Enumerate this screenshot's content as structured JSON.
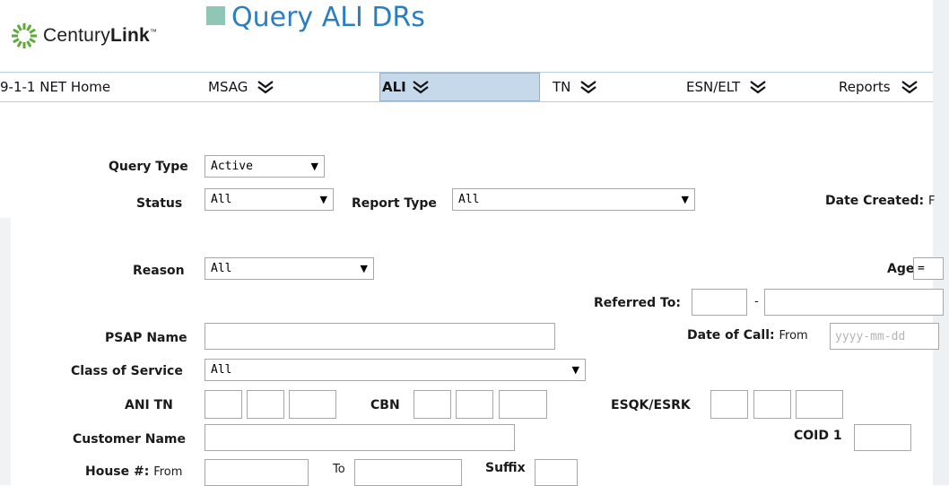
{
  "header": {
    "brand": "CenturyLink",
    "brand_plain": "Century",
    "brand_bold": "Link",
    "brand_tm": "™",
    "page_title": "Query ALI DRs"
  },
  "nav": {
    "items": [
      {
        "label": "9-1-1 NET Home"
      },
      {
        "label": "MSAG"
      },
      {
        "label": "ALI"
      },
      {
        "label": "TN"
      },
      {
        "label": "ESN/ELT"
      },
      {
        "label": "Reports"
      }
    ],
    "active": "ALI"
  },
  "form": {
    "query_type": {
      "label": "Query Type",
      "value": "Active"
    },
    "status": {
      "label": "Status",
      "value": "All"
    },
    "report_type": {
      "label": "Report Type",
      "value": "All"
    },
    "date_created": {
      "label": "Date Created:",
      "from": "F"
    },
    "reason": {
      "label": "Reason",
      "value": "All"
    },
    "age": {
      "label": "Age",
      "operator": "="
    },
    "referred_to": {
      "label": "Referred To:",
      "separator": "-"
    },
    "psap_name": {
      "label": "PSAP Name",
      "value": ""
    },
    "date_of_call": {
      "label": "Date of Call:",
      "from": "From",
      "placeholder": "yyyy-mm-dd"
    },
    "class_of_service": {
      "label": "Class of Service",
      "value": "All"
    },
    "ani_tn": {
      "label": "ANI TN"
    },
    "cbn": {
      "label": "CBN"
    },
    "esqk_esrk": {
      "label": "ESQK/ESRK"
    },
    "customer_name": {
      "label": "Customer Name",
      "value": ""
    },
    "coid1": {
      "label": "COID 1"
    },
    "house_number": {
      "label": "House #:",
      "from": "From",
      "to": "To"
    },
    "suffix": {
      "label": "Suffix"
    }
  },
  "colors": {
    "title": "#2b7fbf",
    "title_square": "#8fc7b4",
    "nav_active_bg": "#c5d9ea",
    "nav_line": "#b9cde0"
  },
  "icons": {
    "logo": "centurylink-logo-icon",
    "nav_chevron": "double-chevron-down-icon"
  }
}
